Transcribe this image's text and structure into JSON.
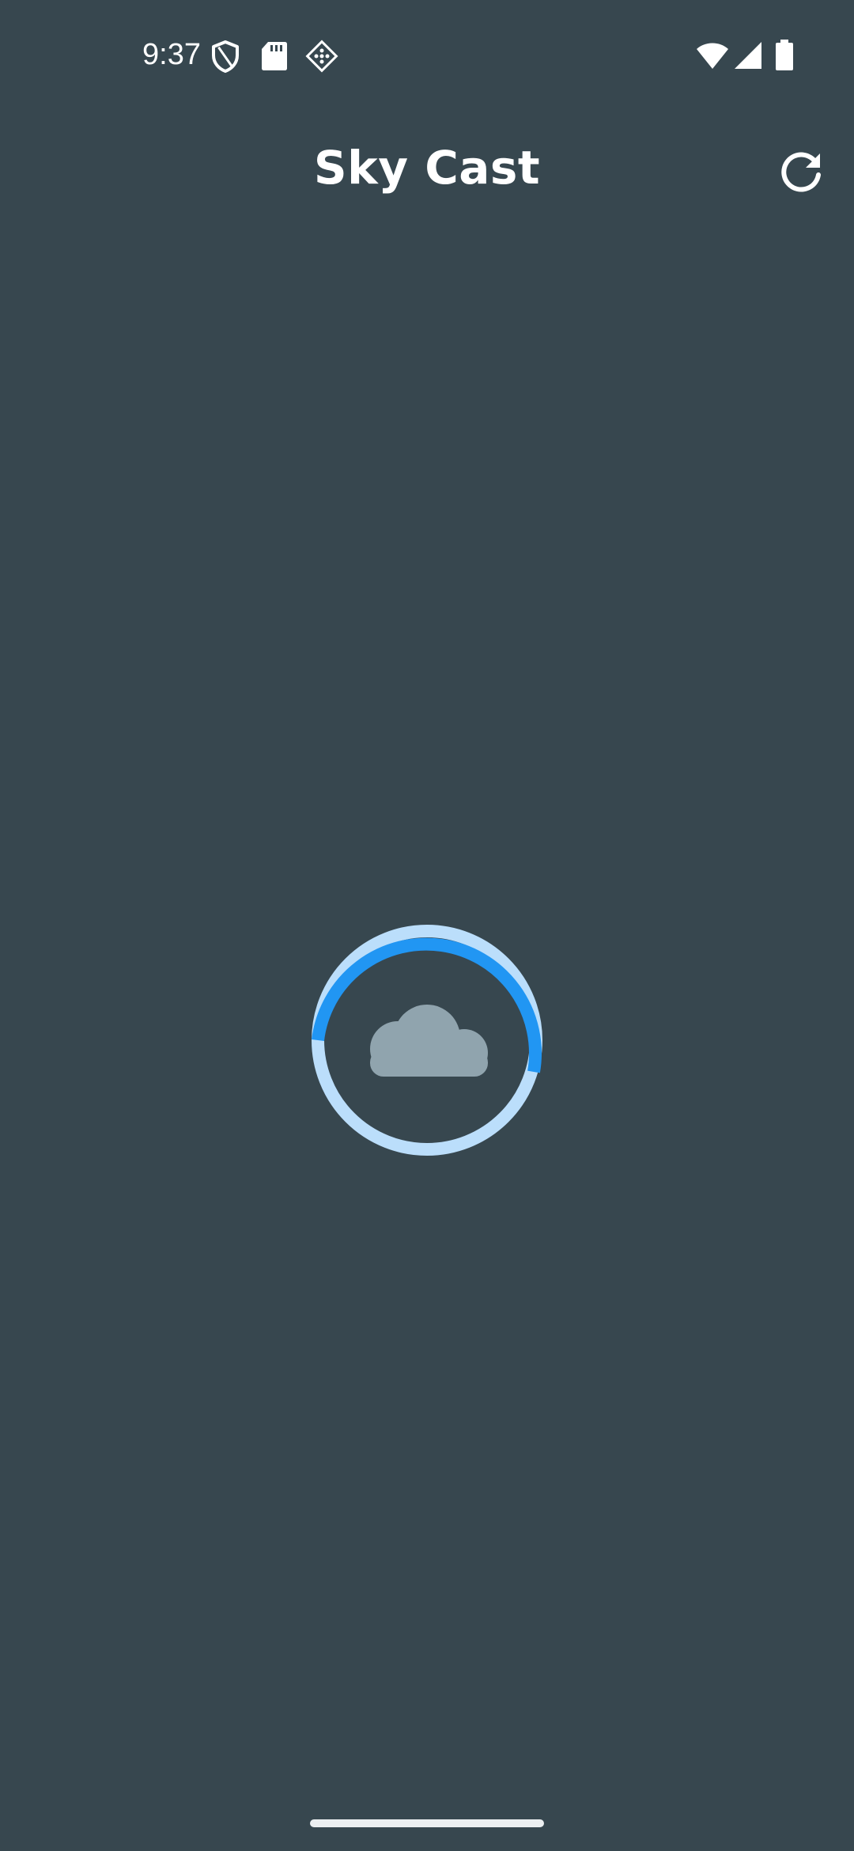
{
  "status_bar": {
    "time": "9:37",
    "left_icons": [
      "shield-icon",
      "sd-card-icon",
      "app-notification-icon"
    ],
    "right_icons": [
      "wifi-icon",
      "cell-signal-icon",
      "battery-icon"
    ]
  },
  "app_bar": {
    "title": "Sky Cast",
    "refresh_icon": "refresh-icon"
  },
  "loading": {
    "icon": "cloud-icon",
    "spinner_colors": {
      "active_arc": "#2196F3",
      "track": "#BBDEFB",
      "cloud": "#90A4AE"
    }
  },
  "colors": {
    "background": "#37474F",
    "text": "#FFFFFF"
  }
}
